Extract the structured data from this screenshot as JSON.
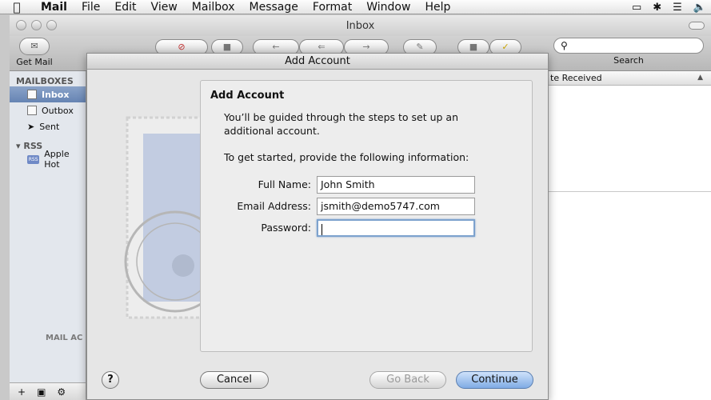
{
  "menubar": {
    "app": "Mail",
    "items": [
      "File",
      "Edit",
      "View",
      "Mailbox",
      "Message",
      "Format",
      "Window",
      "Help"
    ]
  },
  "window": {
    "title": "Inbox"
  },
  "toolbar": {
    "get_mail": "Get Mail",
    "search_label": "Search"
  },
  "sidebar": {
    "mailboxes_header": "MAILBOXES",
    "mailboxes": [
      "Inbox",
      "Outbox",
      "Sent"
    ],
    "rss_header": "RSS",
    "rss_items": [
      "Apple Hot"
    ],
    "mail_activity": "MAIL AC",
    "footer": [
      "+",
      "▣",
      "⚙"
    ]
  },
  "message_list": {
    "column_header": "te Received"
  },
  "sheet": {
    "title": "Add Account",
    "heading": "Add Account",
    "intro": "You’ll be guided through the steps to set up an additional account.",
    "get_started": "To get started, provide the following information:",
    "fields": {
      "full_name": {
        "label": "Full Name:",
        "value": "John Smith"
      },
      "email": {
        "label": "Email Address:",
        "value": "jsmith@demo5747.com"
      },
      "password": {
        "label": "Password:",
        "value": ""
      }
    },
    "buttons": {
      "help": "?",
      "cancel": "Cancel",
      "go_back": "Go Back",
      "continue": "Continue"
    }
  }
}
